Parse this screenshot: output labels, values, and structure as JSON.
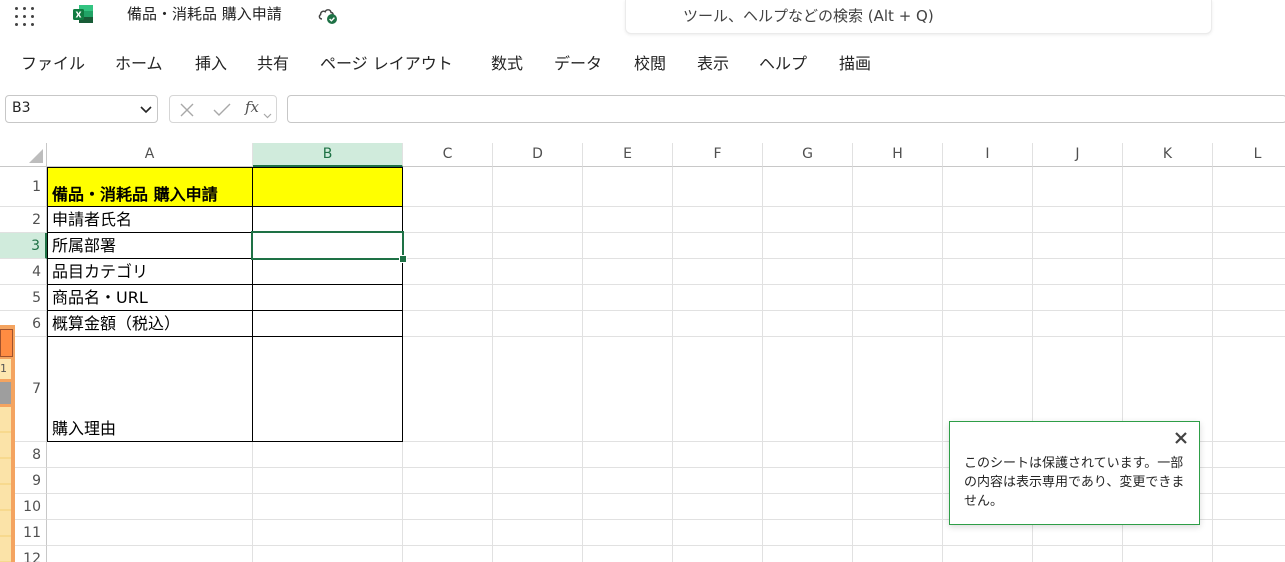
{
  "titlebar": {
    "doc_title": "備品・消耗品 購入申請",
    "search_placeholder": "ツール、ヘルプなどの検索 (Alt + Q)"
  },
  "menu": {
    "items": [
      "ファイル",
      "ホーム",
      "挿入",
      "共有",
      "ページ レイアウト",
      "数式",
      "データ",
      "校閲",
      "表示",
      "ヘルプ",
      "描画"
    ]
  },
  "formula_bar": {
    "name_box": "B3",
    "fx_label": "fx",
    "formula": ""
  },
  "sheet": {
    "columns": [
      "A",
      "B",
      "C",
      "D",
      "E",
      "F",
      "G",
      "H",
      "I",
      "J",
      "K",
      "L"
    ],
    "selected_column": "B",
    "rows": [
      "1",
      "2",
      "3",
      "4",
      "5",
      "6",
      "7",
      "8",
      "9",
      "10",
      "11",
      "12"
    ],
    "selected_row": "3",
    "cells": {
      "A1": "備品・消耗品 購入申請",
      "A2": "申請者氏名",
      "A3": "所属部署",
      "A4": "品目カテゴリ",
      "A5": "商品名・URL",
      "A6": "概算金額（税込）",
      "A7": "購入理由"
    },
    "title_fill_color": "#ffff00"
  },
  "toast": {
    "message": "このシートは保護されています。一部の内容は表示専用であり、変更できません。"
  },
  "left_stub": {
    "label": "1"
  },
  "colors": {
    "accent": "#1e7145",
    "toast_border": "#2e9e47"
  }
}
